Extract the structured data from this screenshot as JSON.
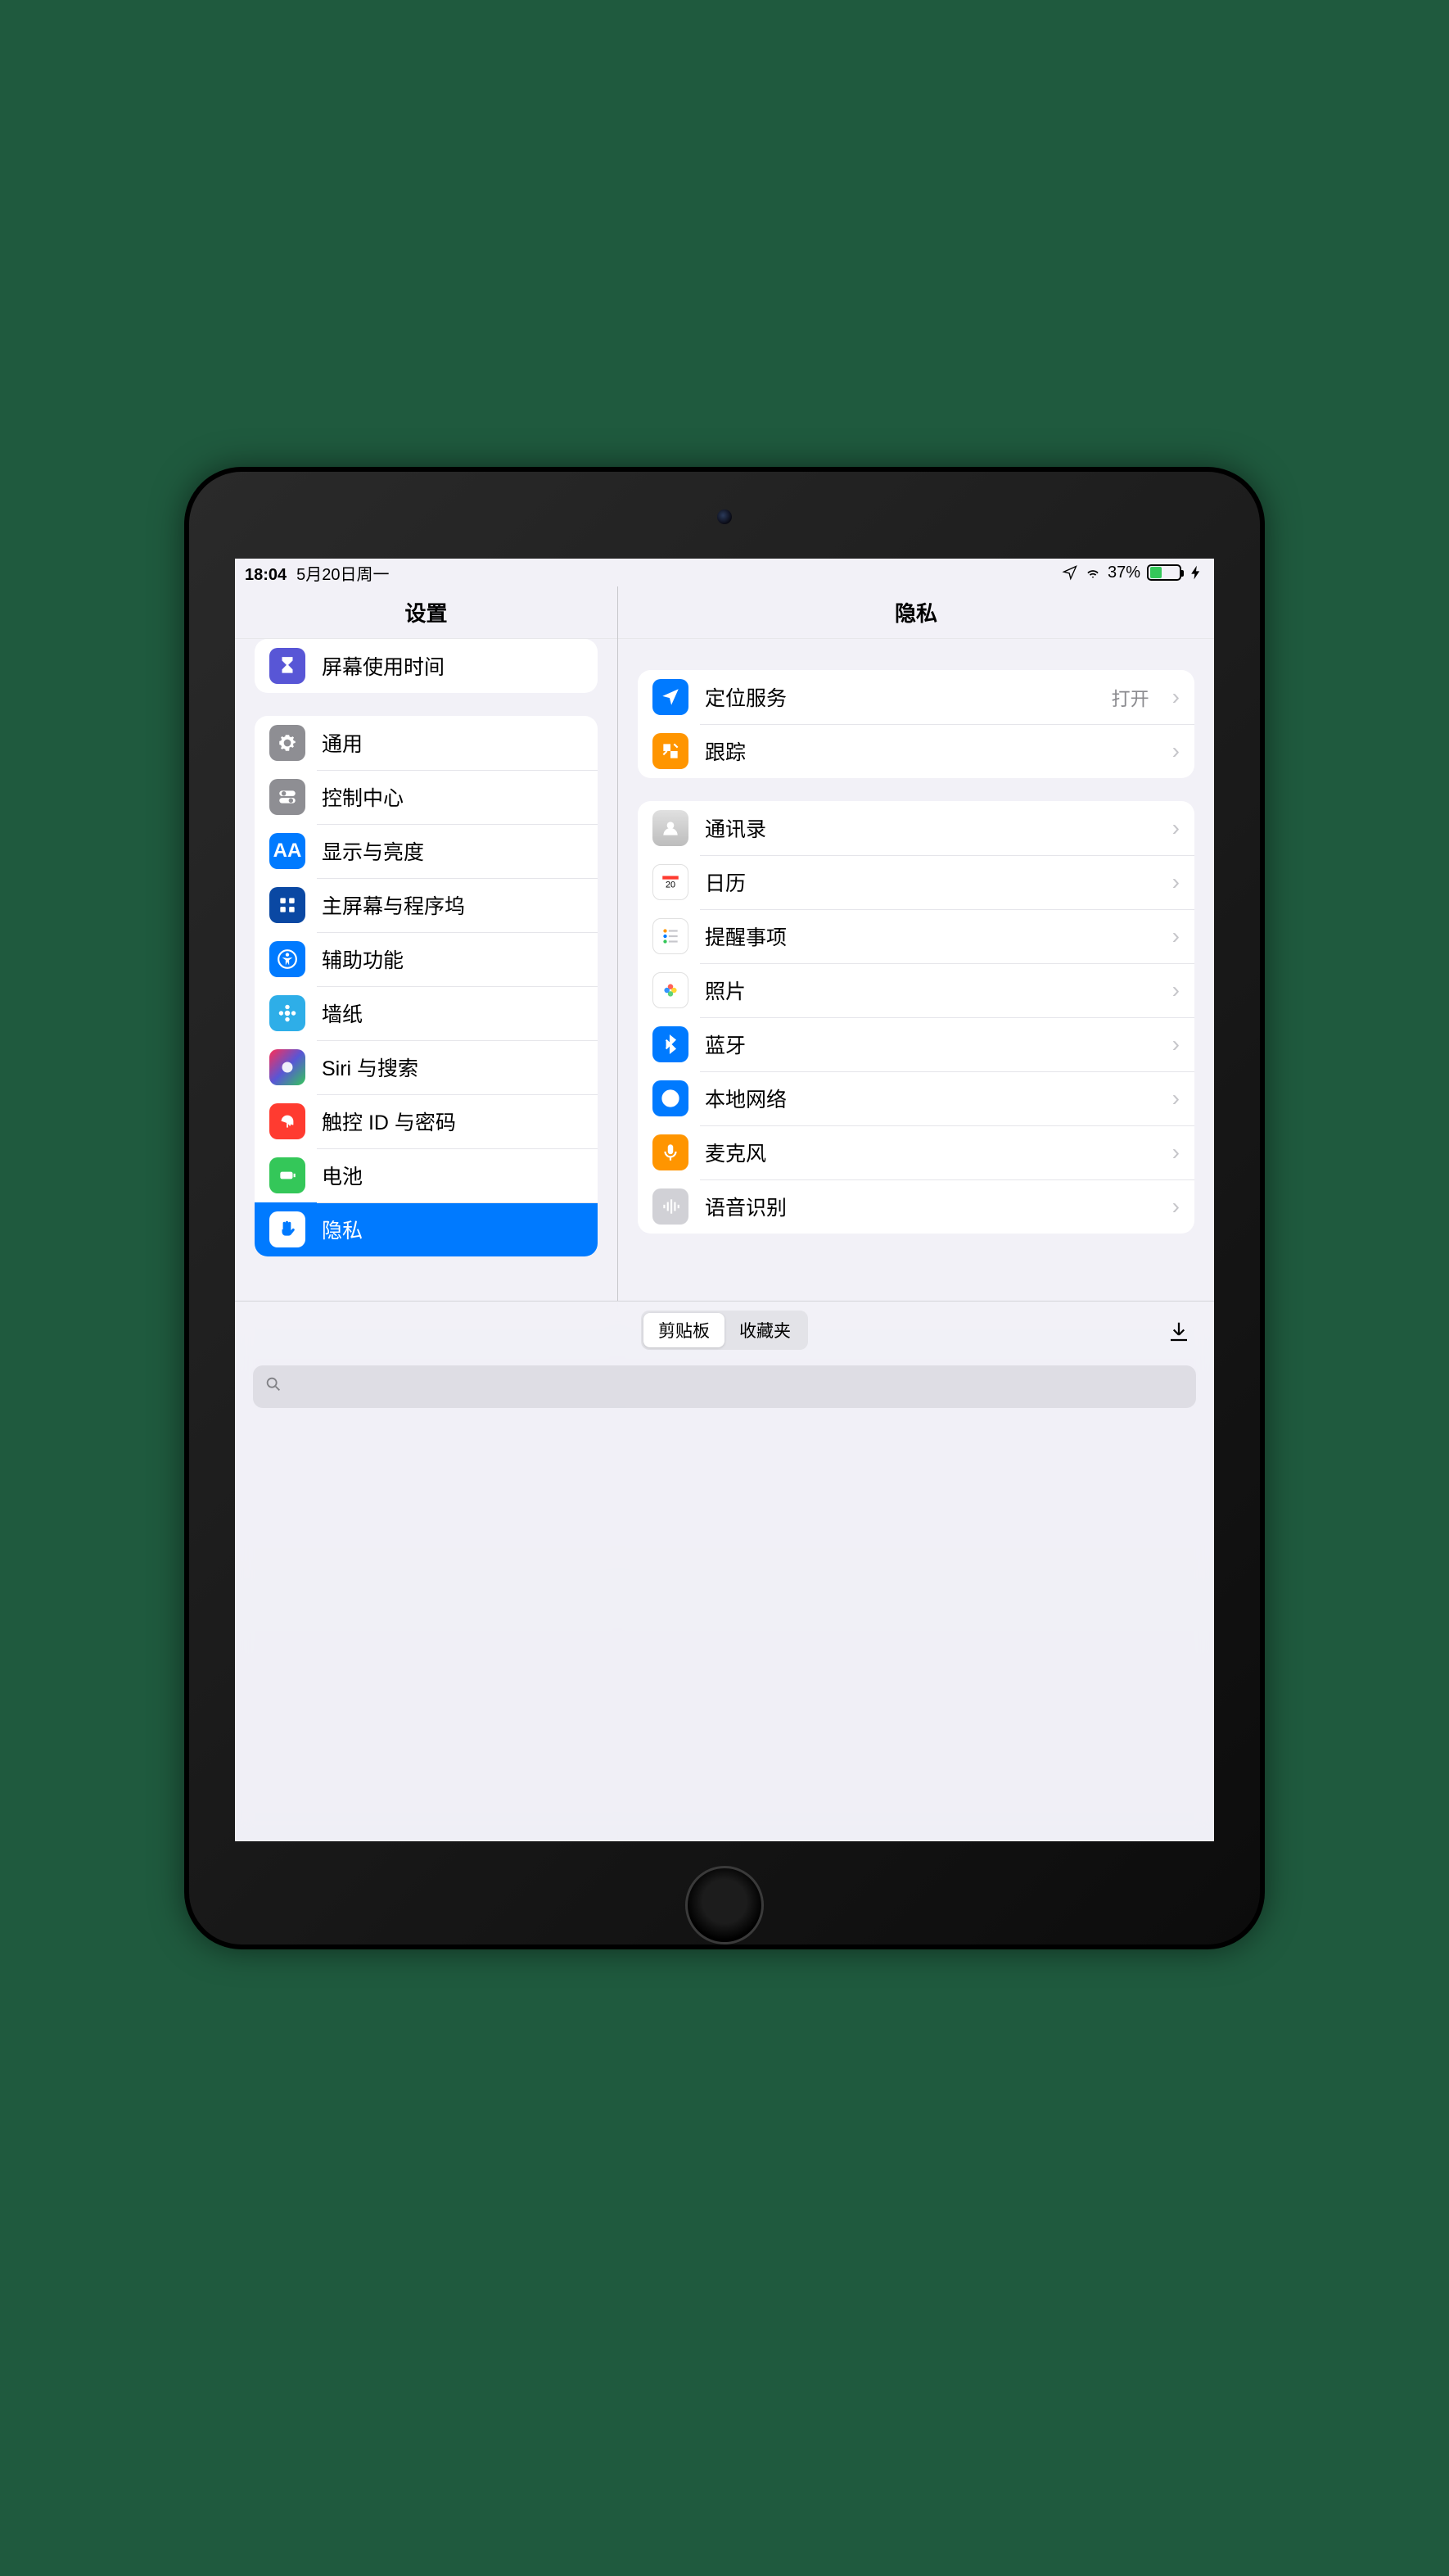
{
  "status": {
    "time": "18:04",
    "date": "5月20日周一",
    "battery_pct": "37%",
    "battery_fill_pct": 37
  },
  "sidebar": {
    "title": "设置",
    "group0": [
      {
        "name": "screen-time",
        "label": "屏幕使用时间"
      }
    ],
    "group1": [
      {
        "name": "general",
        "label": "通用"
      },
      {
        "name": "control-center",
        "label": "控制中心"
      },
      {
        "name": "display",
        "label": "显示与亮度"
      },
      {
        "name": "home-screen",
        "label": "主屏幕与程序坞"
      },
      {
        "name": "accessibility",
        "label": "辅助功能"
      },
      {
        "name": "wallpaper",
        "label": "墙纸"
      },
      {
        "name": "siri",
        "label": "Siri 与搜索"
      },
      {
        "name": "touchid",
        "label": "触控 ID 与密码"
      },
      {
        "name": "battery",
        "label": "电池"
      },
      {
        "name": "privacy",
        "label": "隐私",
        "selected": true
      }
    ]
  },
  "detail": {
    "title": "隐私",
    "group0": [
      {
        "name": "location",
        "label": "定位服务",
        "value": "打开"
      },
      {
        "name": "tracking",
        "label": "跟踪"
      }
    ],
    "group1": [
      {
        "name": "contacts",
        "label": "通讯录"
      },
      {
        "name": "calendar",
        "label": "日历"
      },
      {
        "name": "reminders",
        "label": "提醒事项"
      },
      {
        "name": "photos",
        "label": "照片"
      },
      {
        "name": "bluetooth",
        "label": "蓝牙"
      },
      {
        "name": "local-network",
        "label": "本地网络"
      },
      {
        "name": "microphone",
        "label": "麦克风"
      },
      {
        "name": "speech",
        "label": "语音识别"
      }
    ]
  },
  "panel": {
    "tab_clipboard": "剪贴板",
    "tab_favorites": "收藏夹",
    "search_placeholder": ""
  }
}
